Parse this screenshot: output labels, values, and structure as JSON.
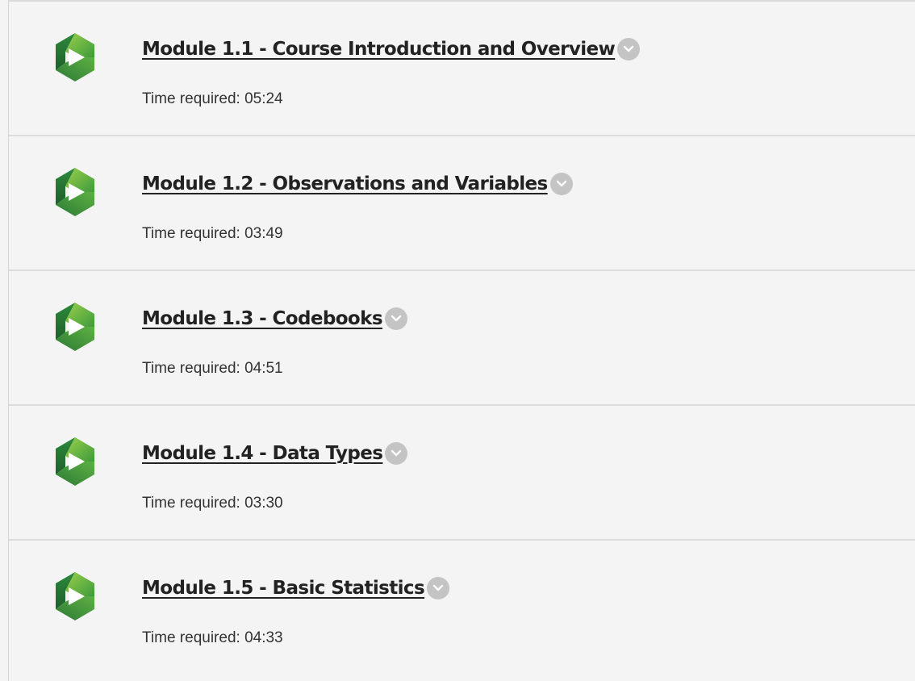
{
  "colors": {
    "icon_green_dark": "#2f7a3a",
    "icon_green_light": "#8cc63f",
    "title_text": "#222222",
    "chevron_bg": "#c4c4c4"
  },
  "modules": [
    {
      "title": "Module 1.1 - Course Introduction and Overview",
      "time_label": "Time required: 05:24",
      "icon": "panopto-play-icon"
    },
    {
      "title": "Module 1.2 - Observations and Variables",
      "time_label": "Time required: 03:49",
      "icon": "panopto-play-icon"
    },
    {
      "title": "Module 1.3 - Codebooks",
      "time_label": "Time required: 04:51",
      "icon": "panopto-play-icon"
    },
    {
      "title": "Module 1.4 - Data Types",
      "time_label": "Time required: 03:30",
      "icon": "panopto-play-icon"
    },
    {
      "title": "Module 1.5 - Basic Statistics",
      "time_label": "Time required: 04:33",
      "icon": "panopto-play-icon"
    }
  ]
}
